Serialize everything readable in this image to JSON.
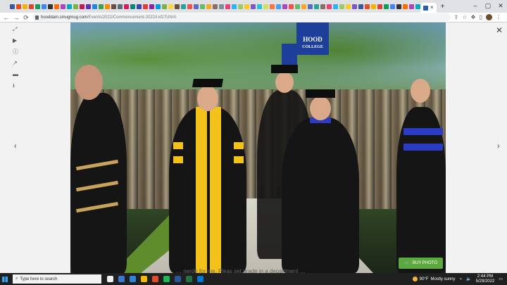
{
  "browser": {
    "url_host": "hooddam.smugmug.com",
    "url_path": "/Events/2022/Commencement-2022/i-kfz7UN/A",
    "tab_close": "×",
    "new_tab": "+",
    "favicon_colors": [
      "#3b5998",
      "#e44d26",
      "#f4b400",
      "#db4437",
      "#0f9d58",
      "#4285f4",
      "#333333",
      "#ff6d00",
      "#ab47bc",
      "#00acc1",
      "#7cb342",
      "#c2185b",
      "#5e35b1",
      "#1e88e5",
      "#43a047",
      "#fb8c00",
      "#6d4c41",
      "#546e7a",
      "#d81b60",
      "#00897b",
      "#3949ab",
      "#e53935",
      "#8e24aa",
      "#039be5",
      "#7cb342",
      "#fdd835",
      "#6d4c41",
      "#26a69a",
      "#ef5350",
      "#5c6bc0",
      "#66bb6a",
      "#ffa726",
      "#8d6e63",
      "#78909c",
      "#ec407a",
      "#29b6f6",
      "#9ccc65",
      "#ffca28",
      "#7e57c2",
      "#26c6da",
      "#d4e157",
      "#ff7043",
      "#42a5f5",
      "#ab47bc",
      "#ef5350",
      "#66bb6a",
      "#ffa726",
      "#5c6bc0",
      "#26a69a",
      "#8d6e63",
      "#ec407a",
      "#29b6f6",
      "#9ccc65",
      "#ffca28",
      "#7e57c2",
      "#3b5998",
      "#e44d26",
      "#f4b400",
      "#db4437",
      "#0f9d58",
      "#4285f4",
      "#333333",
      "#ff6d00",
      "#ab47bc",
      "#00acc1"
    ]
  },
  "photo": {
    "banner_text": "HOOD",
    "banner_text2": "COLLEGE",
    "caption": "… nerde for me. Pleas set grade in a department …"
  },
  "buy_button": {
    "label": "BUY PHOTO"
  },
  "viewer": {
    "prev": "‹",
    "next": "›",
    "close": "✕"
  },
  "taskbar": {
    "search_placeholder": "Type here to search",
    "weather_temp": "90°F",
    "weather_desc": "Mostly sunny",
    "time": "2:44 PM",
    "date": "5/29/2022",
    "app_colors": [
      "#f0f0f0",
      "#3a78d6",
      "#2b88d8",
      "#f7b900",
      "#e34c26",
      "#1db954",
      "#2b579a",
      "#217346",
      "#0078d7"
    ]
  }
}
